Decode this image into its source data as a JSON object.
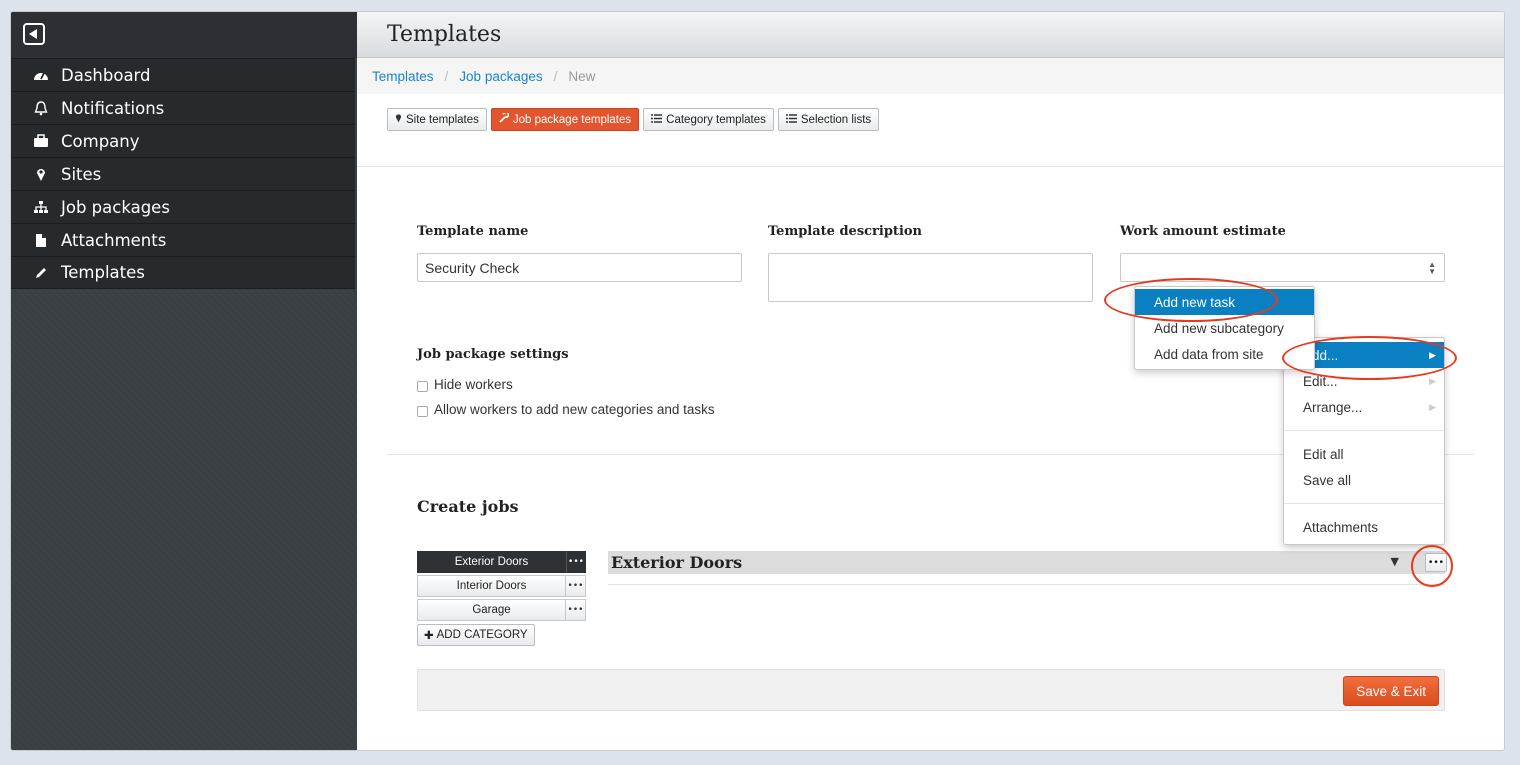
{
  "sidebar": {
    "items": [
      {
        "label": "Dashboard",
        "icon": "dashboard-icon"
      },
      {
        "label": "Notifications",
        "icon": "bell-icon"
      },
      {
        "label": "Company",
        "icon": "briefcase-icon"
      },
      {
        "label": "Sites",
        "icon": "map-pin-icon"
      },
      {
        "label": "Job packages",
        "icon": "sitemap-icon"
      },
      {
        "label": "Attachments",
        "icon": "file-icon"
      },
      {
        "label": "Templates",
        "icon": "pencil-icon"
      }
    ]
  },
  "header": {
    "title": "Templates"
  },
  "breadcrumb": {
    "items": [
      "Templates",
      "Job packages",
      "New"
    ]
  },
  "tabs": [
    {
      "label": "Site templates"
    },
    {
      "label": "Job package templates"
    },
    {
      "label": "Category templates"
    },
    {
      "label": "Selection lists"
    }
  ],
  "form": {
    "name_label": "Template name",
    "name_value": "Security Check",
    "description_label": "Template description",
    "estimate_label": "Work amount estimate",
    "settings_label": "Job package settings",
    "hide_workers": "Hide workers",
    "allow_workers": "Allow workers to add new categories and tasks"
  },
  "jobs": {
    "title": "Create jobs",
    "categories": [
      "Exterior Doors",
      "Interior Doors",
      "Garage"
    ],
    "add_category": "ADD CATEGORY",
    "selected_category": "Exterior Doors"
  },
  "footer": {
    "save": "Save & Exit"
  },
  "context_menu": {
    "items": [
      "Add...",
      "Edit...",
      "Arrange...",
      "Edit all",
      "Save all",
      "Attachments"
    ]
  },
  "submenu": {
    "items": [
      "Add new task",
      "Add new subcategory",
      "Add data from site"
    ]
  },
  "colors": {
    "accent": "#e3552e",
    "link": "#1c84c6",
    "highlight": "#0a7fc1",
    "annotation": "#e8391d"
  }
}
